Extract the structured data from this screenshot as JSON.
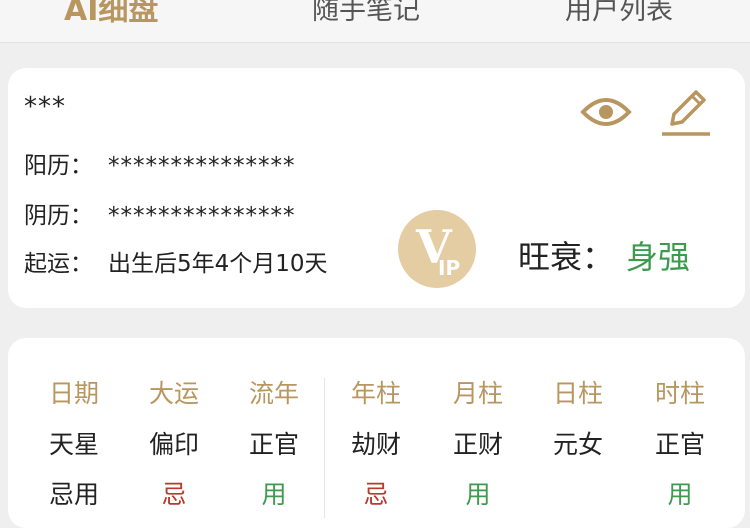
{
  "tabs": [
    {
      "label": "AI细盘"
    },
    {
      "label": "随手笔记"
    },
    {
      "label": "用户列表"
    }
  ],
  "profile": {
    "name": "***",
    "solar_label": "阳历：",
    "solar_value": "***************",
    "lunar_label": "阴历：",
    "lunar_value": "***************",
    "start_label": "起运：",
    "start_value": "出生后5年4个月10天",
    "strength_label": "旺衰：",
    "strength_value": "身强",
    "vip_letters": "V",
    "vip_small": "IP"
  },
  "table": {
    "columns": [
      {
        "header": "日期",
        "r1": "天星",
        "r2": "忌用",
        "r2_style": "dark"
      },
      {
        "header": "大运",
        "r1": "偏印",
        "r2": "忌",
        "r2_style": "red"
      },
      {
        "header": "流年",
        "r1": "正官",
        "r2": "用",
        "r2_style": "green"
      },
      {
        "header": "年柱",
        "r1": "劫财",
        "r2": "忌",
        "r2_style": "red"
      },
      {
        "header": "月柱",
        "r1": "正财",
        "r2": "用",
        "r2_style": "green"
      },
      {
        "header": "日柱",
        "r1": "元女",
        "r2": "",
        "r2_style": "dark"
      },
      {
        "header": "时柱",
        "r1": "正官",
        "r2": "用",
        "r2_style": "green"
      }
    ]
  },
  "colors": {
    "accent": "#b8965f",
    "good": "#3e9b4e",
    "bad": "#b53b2c"
  },
  "icons": {
    "eye": "eye-icon",
    "edit": "pencil-icon"
  }
}
